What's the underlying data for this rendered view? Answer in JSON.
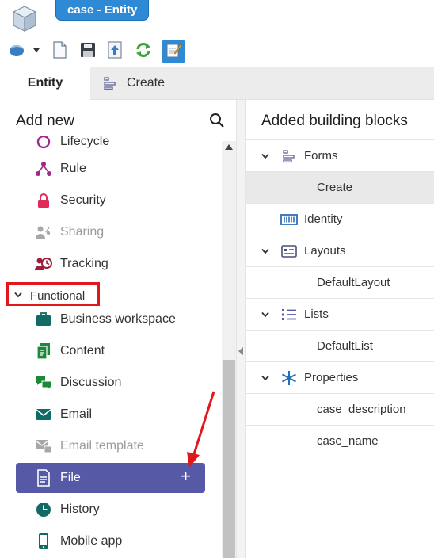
{
  "window": {
    "title": "case - Entity",
    "logo_icon": "cube-logo-icon"
  },
  "toolbar": {
    "items": [
      {
        "icon": "save-dropdown-icon"
      },
      {
        "icon": "new-document-icon"
      },
      {
        "icon": "save-icon"
      },
      {
        "icon": "upload-icon"
      },
      {
        "icon": "refresh-icon"
      },
      {
        "icon": "edit-icon"
      }
    ]
  },
  "tabs": [
    {
      "label": "Entity",
      "active": true
    },
    {
      "label": "Create",
      "icon": "form-icon",
      "active": false
    }
  ],
  "left_panel": {
    "title": "Add new",
    "search_icon": "search-icon",
    "partial_item": "Lifecycle",
    "items_top": [
      {
        "label": "Rule",
        "icon": "rule-icon",
        "color": "#a0288c",
        "disabled": false
      },
      {
        "label": "Security",
        "icon": "lock-icon",
        "color": "#e02a5a",
        "disabled": false
      },
      {
        "label": "Sharing",
        "icon": "sharing-icon",
        "color": "#a8a8a8",
        "disabled": true
      },
      {
        "label": "Tracking",
        "icon": "tracking-icon",
        "color": "#9c1e3c",
        "disabled": false
      }
    ],
    "group": {
      "label": "Functional",
      "expanded": true
    },
    "items_functional": [
      {
        "label": "Business workspace",
        "icon": "briefcase-icon",
        "color": "#0f6b63",
        "disabled": false
      },
      {
        "label": "Content",
        "icon": "content-icon",
        "color": "#1a8a3a",
        "disabled": false
      },
      {
        "label": "Discussion",
        "icon": "discussion-icon",
        "color": "#1a8a3a",
        "disabled": false
      },
      {
        "label": "Email",
        "icon": "email-icon",
        "color": "#0f6b63",
        "disabled": false
      },
      {
        "label": "Email template",
        "icon": "email-template-icon",
        "color": "#a8a8a8",
        "disabled": true
      },
      {
        "label": "File",
        "icon": "file-icon",
        "color": "#ffffff",
        "disabled": false,
        "selected": true,
        "action": "+"
      },
      {
        "label": "History",
        "icon": "history-icon",
        "color": "#0f6b63",
        "disabled": false
      },
      {
        "label": "Mobile app",
        "icon": "mobile-icon",
        "color": "#0f6b63",
        "disabled": false
      }
    ]
  },
  "right_panel": {
    "title": "Added building blocks",
    "rows": [
      {
        "label": "Forms",
        "icon": "forms-icon",
        "expandable": true
      },
      {
        "label": "Create",
        "child": true,
        "selected": true
      },
      {
        "label": "Identity",
        "icon": "identity-icon",
        "expandable": false
      },
      {
        "label": "Layouts",
        "icon": "layouts-icon",
        "expandable": true
      },
      {
        "label": "DefaultLayout",
        "child": true
      },
      {
        "label": "Lists",
        "icon": "lists-icon",
        "expandable": true
      },
      {
        "label": "DefaultList",
        "child": true
      },
      {
        "label": "Properties",
        "icon": "properties-icon",
        "expandable": true
      },
      {
        "label": "case_description",
        "child": true
      },
      {
        "label": "case_name",
        "child": true
      }
    ]
  },
  "colors": {
    "accent": "#2f8ad6",
    "selection": "#5559a6",
    "highlight_box": "#e0181b",
    "annotation_arrow": "#e0181b"
  }
}
